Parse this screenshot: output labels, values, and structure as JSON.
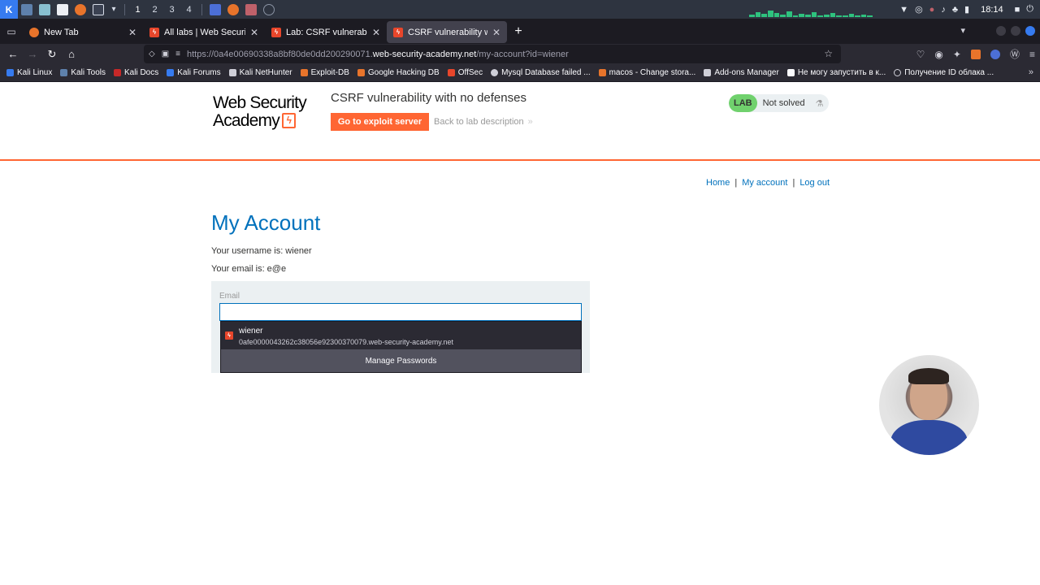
{
  "taskbar": {
    "workspaces": [
      "1",
      "2",
      "3",
      "4"
    ],
    "clock": "18:14",
    "colors": {
      "bg": "#2e3440",
      "accent": "#367bf0"
    }
  },
  "browser": {
    "tabs": [
      {
        "title": "New Tab",
        "favicon": "firefox-icon",
        "active": false
      },
      {
        "title": "All labs | Web Security Ac",
        "favicon": "portswigger-icon",
        "active": false
      },
      {
        "title": "Lab: CSRF vulnerability wi",
        "favicon": "portswigger-icon",
        "active": false
      },
      {
        "title": "CSRF vulnerability with no",
        "favicon": "portswigger-icon",
        "active": true
      }
    ],
    "url": {
      "prefix": "https://0a4e00690338a8bf80de0dd200290071.",
      "host": "web-security-academy.net",
      "path": "/my-account?id=wiener"
    },
    "bookmarks": [
      "Kali Linux",
      "Kali Tools",
      "Kali Docs",
      "Kali Forums",
      "Kali NetHunter",
      "Exploit-DB",
      "Google Hacking DB",
      "OffSec",
      "Mysql Database failed ...",
      "macos - Change stora...",
      "Add-ons Manager",
      "Не могу запустить в к...",
      "Получение ID облака ..."
    ]
  },
  "page": {
    "logo_line1": "Web Security",
    "logo_line2": "Academy",
    "lab_title": "CSRF vulnerability with no defenses",
    "exploit_button": "Go to exploit server",
    "back_link": "Back to lab description",
    "lab_badge": "LAB",
    "lab_status": "Not solved",
    "nav": [
      "Home",
      "My account",
      "Log out"
    ],
    "heading": "My Account",
    "username_line": "Your username is: wiener",
    "email_line": "Your email is: e@e",
    "email_label": "Email",
    "email_value": "",
    "autocomplete": {
      "username": "wiener",
      "site": "0afe0000043262c38056e92300370079.web-security-academy.net",
      "manage": "Manage Passwords"
    },
    "colors": {
      "brand": "#ff6633",
      "link": "#0071bc",
      "solved_badge": "#70d16d"
    }
  }
}
